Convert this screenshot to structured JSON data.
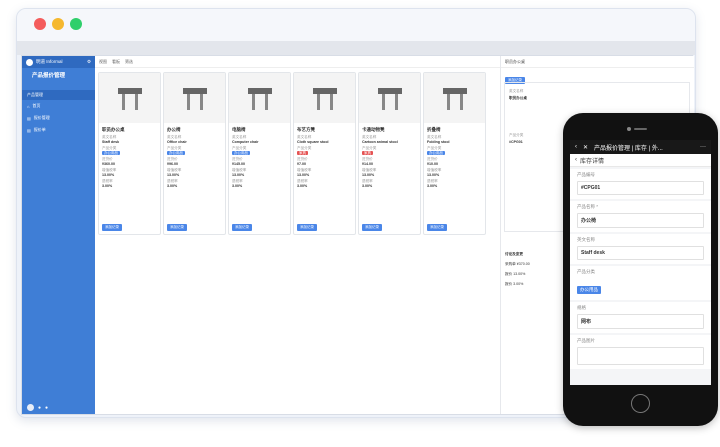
{
  "sidebar": {
    "brand": "明道 Informal",
    "app_name": "产品报价管理",
    "section": "产品管理",
    "items": [
      "首页",
      "报价管理",
      "报价单"
    ]
  },
  "toolbar": {
    "items": [
      "视图",
      "看板",
      "筛选"
    ]
  },
  "products": [
    {
      "name": "职员办公桌",
      "en": "Staff desk",
      "category": "办公用品",
      "cat_color": "blue",
      "price": "¥360.00",
      "margin1": "13.00%",
      "margin2": "3.00%"
    },
    {
      "name": "办公椅",
      "en": "Office chair",
      "category": "办公用品",
      "cat_color": "blue",
      "price": "¥96.00",
      "margin1": "13.00%",
      "margin2": "3.00%"
    },
    {
      "name": "电脑椅",
      "en": "Computer chair",
      "category": "办公用品",
      "cat_color": "blue",
      "price": "¥145.00",
      "margin1": "13.00%",
      "margin2": "3.00%"
    },
    {
      "name": "布艺方凳",
      "en": "Cloth square stool",
      "category": "家具",
      "cat_color": "red",
      "price": "¥7.00",
      "margin1": "13.00%",
      "margin2": "3.00%"
    },
    {
      "name": "卡通动物凳",
      "en": "Cartoon animal stool",
      "category": "家具",
      "cat_color": "red",
      "price": "¥14.00",
      "margin1": "13.00%",
      "margin2": "3.00%"
    },
    {
      "name": "折叠椅",
      "en": "Folding stool",
      "category": "办公用品",
      "cat_color": "blue",
      "price": "¥10.00",
      "margin1": "13.00%",
      "margin2": "3.00%"
    }
  ],
  "labels": {
    "en_name": "英文名称",
    "category": "产品分类",
    "price": "进货价",
    "margin": "增值税率",
    "tax": "退税率",
    "add": "添加记录"
  },
  "panel": {
    "title": "职员办公桌",
    "code": "#CPG01",
    "activity_title": "讨论及变更",
    "activity": [
      "采购单 ¥370.00",
      "报价 13.00%",
      "报价 3.00%"
    ]
  },
  "phone": {
    "nav_title": "产品报价管理 | 库存 | 外...",
    "sub_title": "库存详情",
    "fields": [
      {
        "label": "产品编号",
        "value": "#CPG01"
      },
      {
        "label": "产品名称 *",
        "value": "办公椅"
      },
      {
        "label": "英文名称",
        "value": "Staff desk"
      },
      {
        "label": "产品分类",
        "value": "办公用品",
        "tag": true
      },
      {
        "label": "规格",
        "value": "网布"
      },
      {
        "label": "产品图片",
        "value": ""
      }
    ]
  }
}
